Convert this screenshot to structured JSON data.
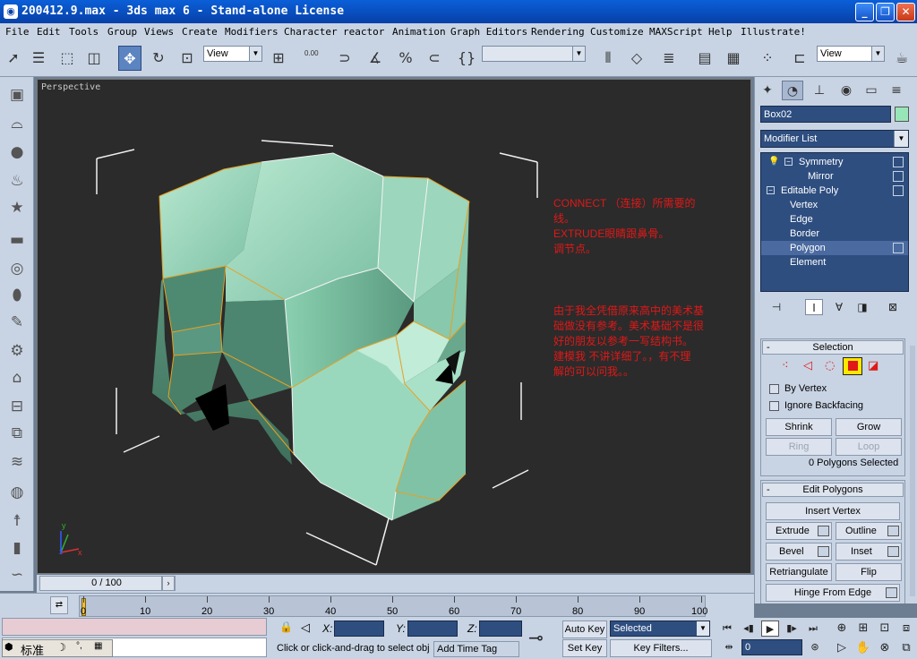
{
  "window": {
    "title": "200412.9.max - 3ds max 6 - Stand-alone License"
  },
  "menu": [
    "File",
    "Edit",
    "Tools",
    "Group",
    "Views",
    "Create",
    "Modifiers",
    "Character",
    "reactor",
    "Animation",
    "Graph Editors",
    "Rendering",
    "Customize",
    "MAXScript",
    "Help",
    "Illustrate!"
  ],
  "toolbar": {
    "ref_coord": "View",
    "spinner_snap": "0.00",
    "named_sel": "",
    "render_view": "View"
  },
  "viewport": {
    "label": "Perspective",
    "note1": [
      "CONNECT （连接）所需要的",
      "线。",
      "EXTRUDE眼睛跟鼻骨。",
      "调节点。"
    ],
    "note2": [
      "由于我全凭借原来高中的美术基",
      "础做没有参考。美术基础不是很",
      "好的朋友以参考一写结构书。",
      "建模我 不讲详细了。，有不理",
      "解的可以问我。。"
    ],
    "axis": {
      "x": "x",
      "y": "y",
      "z": "z"
    }
  },
  "command_panel": {
    "object_name": "Box02",
    "object_color": "#98e6b8",
    "modifier_list": "Modifier List",
    "stack": {
      "symmetry": "Symmetry",
      "mirror": "Mirror",
      "editable_poly": "Editable Poly",
      "vertex": "Vertex",
      "edge": "Edge",
      "border": "Border",
      "polygon": "Polygon",
      "element": "Element"
    },
    "selection": {
      "title": "Selection",
      "by_vertex": "By Vertex",
      "ignore_backfacing": "Ignore Backfacing",
      "shrink": "Shrink",
      "grow": "Grow",
      "ring": "Ring",
      "loop": "Loop",
      "status": "0 Polygons Selected"
    },
    "edit_polygons": {
      "title": "Edit Polygons",
      "insert_vertex": "Insert Vertex",
      "extrude": "Extrude",
      "outline": "Outline",
      "bevel": "Bevel",
      "inset": "Inset",
      "retriangulate": "Retriangulate",
      "flip": "Flip",
      "hinge_from_edge": "Hinge From Edge"
    }
  },
  "timeline": {
    "slider": "0 / 100",
    "ticks": [
      "0",
      "10",
      "20",
      "30",
      "40",
      "50",
      "60",
      "70",
      "80",
      "90",
      "100"
    ]
  },
  "status": {
    "x_label": "X:",
    "y_label": "Y:",
    "z_label": "Z:",
    "prompt": "Click or click-and-drag to select obj",
    "add_time_tag": "Add Time Tag",
    "auto_key": "Auto Key",
    "set_key": "Set Key",
    "selected": "Selected",
    "key_filters": "Key Filters...",
    "frame": "0",
    "ime_mode": "标准"
  },
  "colors": {
    "accent": "#5c84c0",
    "note_red": "#e01818",
    "panel": "#c8d4e4",
    "field": "#2e4e80"
  }
}
